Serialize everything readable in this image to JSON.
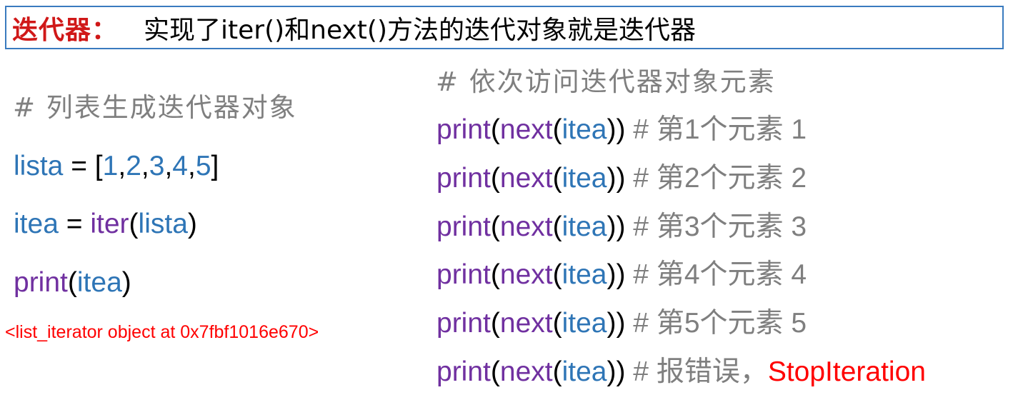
{
  "title": {
    "label": "迭代器：",
    "text": "实现了iter()和next()方法的迭代对象就是迭代器"
  },
  "left_block": {
    "comment": "# 列表生成迭代器对象",
    "lines": [
      [
        {
          "text": "lista",
          "color": "#2e75b6"
        },
        {
          "text": " = [",
          "color": "#000000"
        },
        {
          "text": "1",
          "color": "#2e75b6"
        },
        {
          "text": ",",
          "color": "#000000"
        },
        {
          "text": "2",
          "color": "#2e75b6"
        },
        {
          "text": ",",
          "color": "#000000"
        },
        {
          "text": "3",
          "color": "#2e75b6"
        },
        {
          "text": ",",
          "color": "#000000"
        },
        {
          "text": "4",
          "color": "#2e75b6"
        },
        {
          "text": ",",
          "color": "#000000"
        },
        {
          "text": "5",
          "color": "#2e75b6"
        },
        {
          "text": "]",
          "color": "#000000"
        }
      ],
      [
        {
          "text": "itea",
          "color": "#2e75b6"
        },
        {
          "text": " = ",
          "color": "#000000"
        },
        {
          "text": "iter",
          "color": "#7030a0"
        },
        {
          "text": "(",
          "color": "#000000"
        },
        {
          "text": "lista",
          "color": "#2e75b6"
        },
        {
          "text": ")",
          "color": "#000000"
        }
      ],
      [
        {
          "text": "print",
          "color": "#7030a0"
        },
        {
          "text": "(",
          "color": "#000000"
        },
        {
          "text": "itea",
          "color": "#2e75b6"
        },
        {
          "text": ")",
          "color": "#000000"
        }
      ]
    ],
    "output": "<list_iterator object at 0x7fbf1016e670>"
  },
  "right_block": {
    "comment": "# 依次访问迭代器对象元素",
    "lines": [
      [
        {
          "text": "print",
          "color": "#7030a0"
        },
        {
          "text": "(",
          "color": "#000000"
        },
        {
          "text": "next",
          "color": "#7030a0"
        },
        {
          "text": "(",
          "color": "#000000"
        },
        {
          "text": "itea",
          "color": "#2e75b6"
        },
        {
          "text": ")) ",
          "color": "#000000"
        },
        {
          "text": "# 第1个元素 1",
          "color": "#7f7f7f"
        }
      ],
      [
        {
          "text": "print",
          "color": "#7030a0"
        },
        {
          "text": "(",
          "color": "#000000"
        },
        {
          "text": "next",
          "color": "#7030a0"
        },
        {
          "text": "(",
          "color": "#000000"
        },
        {
          "text": "itea",
          "color": "#2e75b6"
        },
        {
          "text": ")) ",
          "color": "#000000"
        },
        {
          "text": "# 第2个元素 2",
          "color": "#7f7f7f"
        }
      ],
      [
        {
          "text": "print",
          "color": "#7030a0"
        },
        {
          "text": "(",
          "color": "#000000"
        },
        {
          "text": "next",
          "color": "#7030a0"
        },
        {
          "text": "(",
          "color": "#000000"
        },
        {
          "text": "itea",
          "color": "#2e75b6"
        },
        {
          "text": ")) ",
          "color": "#000000"
        },
        {
          "text": "# 第3个元素 3",
          "color": "#7f7f7f"
        }
      ],
      [
        {
          "text": "print",
          "color": "#7030a0"
        },
        {
          "text": "(",
          "color": "#000000"
        },
        {
          "text": "next",
          "color": "#7030a0"
        },
        {
          "text": "(",
          "color": "#000000"
        },
        {
          "text": "itea",
          "color": "#2e75b6"
        },
        {
          "text": ")) ",
          "color": "#000000"
        },
        {
          "text": "# 第4个元素 4",
          "color": "#7f7f7f"
        }
      ],
      [
        {
          "text": "print",
          "color": "#7030a0"
        },
        {
          "text": "(",
          "color": "#000000"
        },
        {
          "text": "next",
          "color": "#7030a0"
        },
        {
          "text": "(",
          "color": "#000000"
        },
        {
          "text": "itea",
          "color": "#2e75b6"
        },
        {
          "text": ")) ",
          "color": "#000000"
        },
        {
          "text": "# 第5个元素 5",
          "color": "#7f7f7f"
        }
      ],
      [
        {
          "text": "print",
          "color": "#7030a0"
        },
        {
          "text": "(",
          "color": "#000000"
        },
        {
          "text": "next",
          "color": "#7030a0"
        },
        {
          "text": "(",
          "color": "#000000"
        },
        {
          "text": "itea",
          "color": "#2e75b6"
        },
        {
          "text": ")) ",
          "color": "#000000"
        },
        {
          "text": "# 报错误，",
          "color": "#7f7f7f"
        },
        {
          "text": "StopIteration",
          "color": "#ff0000"
        }
      ]
    ]
  }
}
